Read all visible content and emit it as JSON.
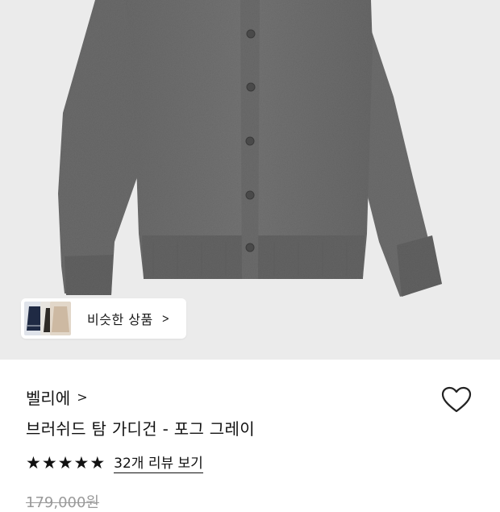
{
  "similar": {
    "label": "비슷한 상품",
    "chevron_icon": "chevron-right-icon"
  },
  "product": {
    "brand": "벨리에",
    "brand_chevron_icon": "chevron-right-icon",
    "title": "브러쉬드 탐 가디건 - 포그 그레이",
    "rating_stars": 5,
    "review_link": "32개 리뷰 보기",
    "original_price": "179,000원",
    "wish_icon": "heart-outline-icon"
  },
  "colors": {
    "hero_background": "#ebebeb",
    "cardigan": "#6f6f6f",
    "text": "#111111",
    "muted_price": "#9a9a9a"
  }
}
